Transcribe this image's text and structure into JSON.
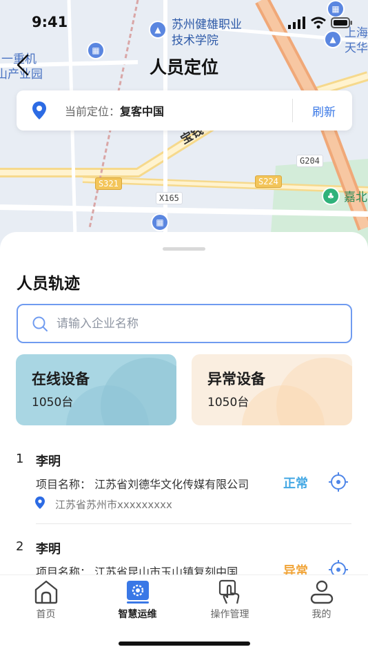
{
  "status_bar": {
    "time": "9:41"
  },
  "map": {
    "labels": [
      "苏州健雄职业",
      "技术学院",
      "一重机",
      "山产业园",
      "上海",
      "天华",
      "宝钱",
      "嘉北"
    ],
    "road_tags": [
      "G204",
      "S321",
      "S224",
      "X165"
    ]
  },
  "nav": {
    "title": "人员定位"
  },
  "location": {
    "prefix": "当前定位：",
    "value": "复客中国",
    "refresh_label": "刷新"
  },
  "sheet": {
    "title": "人员轨迹",
    "search": {
      "placeholder": "请输入企业名称",
      "value": ""
    },
    "stats": [
      {
        "label": "在线设备",
        "value": "1050台"
      },
      {
        "label": "异常设备",
        "value": "1050台"
      }
    ],
    "people": [
      {
        "index": "1",
        "name": "李明",
        "project": "项目名称：  江苏省刘德华文化传媒有限公司",
        "status": "正常",
        "address": "江苏省苏州市xxxxxxxxx"
      },
      {
        "index": "2",
        "name": "李明",
        "project": "项目名称：  江苏省昆山市玉山镇复刻中国",
        "status": "异常"
      }
    ]
  },
  "tabs": [
    {
      "label": "首页",
      "icon": "home-icon"
    },
    {
      "label": "智慧运维",
      "icon": "gear-icon"
    },
    {
      "label": "操作管理",
      "icon": "hand-tap-icon"
    },
    {
      "label": "我的",
      "icon": "user-icon"
    }
  ],
  "colors": {
    "accent": "#3a78e6",
    "normal": "#44a8e4",
    "abnormal": "#f1a53a",
    "online_card": "#a9d6e3",
    "abnormal_card": "#faeee0"
  }
}
